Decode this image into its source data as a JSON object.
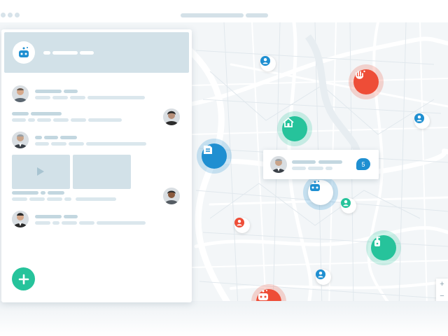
{
  "map": {
    "popup": {
      "message_count": "5"
    },
    "zoom": {
      "in_label": "+",
      "out_label": "−"
    }
  },
  "colors": {
    "accent_blue": "#1f8fd1",
    "accent_green": "#26c39b",
    "accent_red": "#ee4d37",
    "panel_gray": "#d2e1e8"
  },
  "icons": {
    "app_logo": "robot-hand-icon",
    "add": "plus-icon",
    "play": "play-icon",
    "markers": [
      "hand-wash-icon",
      "home-icon",
      "service-icon",
      "robot-hand-icon",
      "soap-bottle-icon",
      "robot-hand-icon",
      "person-icon"
    ]
  }
}
